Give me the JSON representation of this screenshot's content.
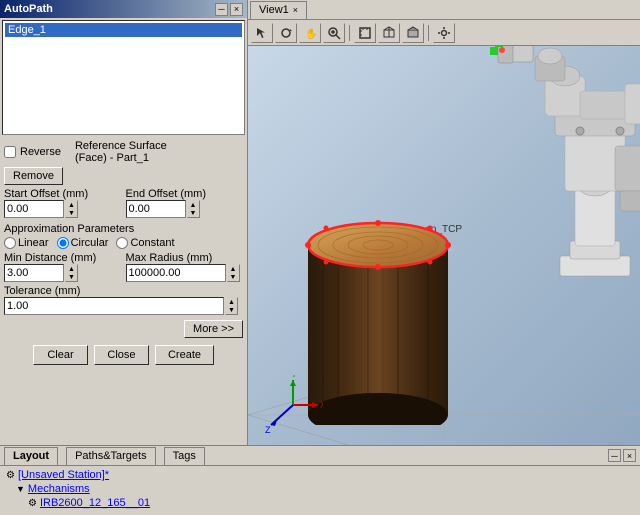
{
  "autopath_panel": {
    "title": "AutoPath",
    "edge_list": {
      "items": [
        "Edge_1"
      ]
    },
    "reverse_label": "Reverse",
    "remove_btn": "Remove",
    "reference_surface_label": "Reference Surface",
    "reference_surface_value": "(Face) - Part_1",
    "start_offset_label": "Start Offset (mm)",
    "start_offset_value": "0.00",
    "end_offset_label": "End Offset (mm)",
    "end_offset_value": "0.00",
    "approx_params_label": "Approximation Parameters",
    "linear_label": "Linear",
    "circular_label": "Circular",
    "constant_label": "Constant",
    "min_distance_label": "Min Distance (mm)",
    "min_distance_value": "3.00",
    "max_radius_label": "Max Radius (mm)",
    "max_radius_value": "100000.00",
    "tolerance_label": "Tolerance (mm)",
    "tolerance_value": "1.00",
    "more_btn": "More >>",
    "clear_btn": "Clear",
    "close_btn": "Close",
    "create_btn": "Create"
  },
  "view_panel": {
    "title": "View1",
    "tcp_label": "en_TCP",
    "toolbar_icons": [
      "cursor",
      "rotate",
      "pan",
      "zoom",
      "fit",
      "separator",
      "wireframe",
      "shaded",
      "separator2",
      "settings"
    ]
  },
  "bottom_panel": {
    "tabs": [
      "Layout",
      "Paths&Targets",
      "Tags"
    ],
    "tree_items": [
      {
        "level": 0,
        "icon": "⚙",
        "text": "[Unsaved Station]*",
        "type": "station"
      },
      {
        "level": 1,
        "icon": "",
        "text": "Mechanisms",
        "type": "group"
      },
      {
        "level": 2,
        "icon": "🤖",
        "text": "IRB2600_12_165__01",
        "type": "robot"
      }
    ]
  },
  "icons": {
    "close": "×",
    "pin": "📌",
    "arrow_down": "▼",
    "arrow_up": "▲",
    "spin_up": "▲",
    "spin_down": "▼"
  }
}
